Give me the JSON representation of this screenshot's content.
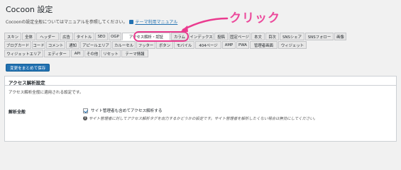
{
  "page": {
    "title": "Cocoon 設定",
    "description": "Cocoonの設定全般についてはマニュアルを参照してください。",
    "manual_link": "テーマ利用マニュアル"
  },
  "annotation": {
    "callout": "クリック",
    "color": "#ea3b8f"
  },
  "tabs": {
    "row1": [
      "スキン",
      "全体",
      "ヘッダー",
      "広告",
      "タイトル",
      "SEO",
      "OGP",
      "アクセス解析・認証",
      "カラム",
      "インデックス",
      "投稿",
      "固定ページ",
      "本文",
      "目次",
      "SNSシェア",
      "SNSフォロー",
      "画像"
    ],
    "row2": [
      "ブログカード",
      "コード",
      "コメント",
      "通知",
      "アピールエリア",
      "カルーセル",
      "フッター",
      "ボタン",
      "モバイル",
      "404ページ",
      "AMP",
      "PWA",
      "管理者画面",
      "ウィジェット"
    ],
    "row3": [
      "ウィジェットエリア",
      "エディター",
      "API",
      "その他",
      "リセット",
      "テーマ情報"
    ],
    "active": "アクセス解析・認証"
  },
  "save_button": "変更をまとめて保存",
  "panel": {
    "title": "アクセス解析設定",
    "description": "アクセス解析全般に適用される設定です。",
    "setting_label": "解析全般",
    "checkbox_label": "サイト管理者も含めてアクセス解析する",
    "checkbox_checked": true,
    "hint": "サイト管理者に対してアクセス解析タグを出力するかどうかの設定です。サイト管理者を解析したくない場合は無効にしてください。"
  },
  "colors": {
    "accent": "#2271b1",
    "highlight": "#ea3b8f"
  }
}
